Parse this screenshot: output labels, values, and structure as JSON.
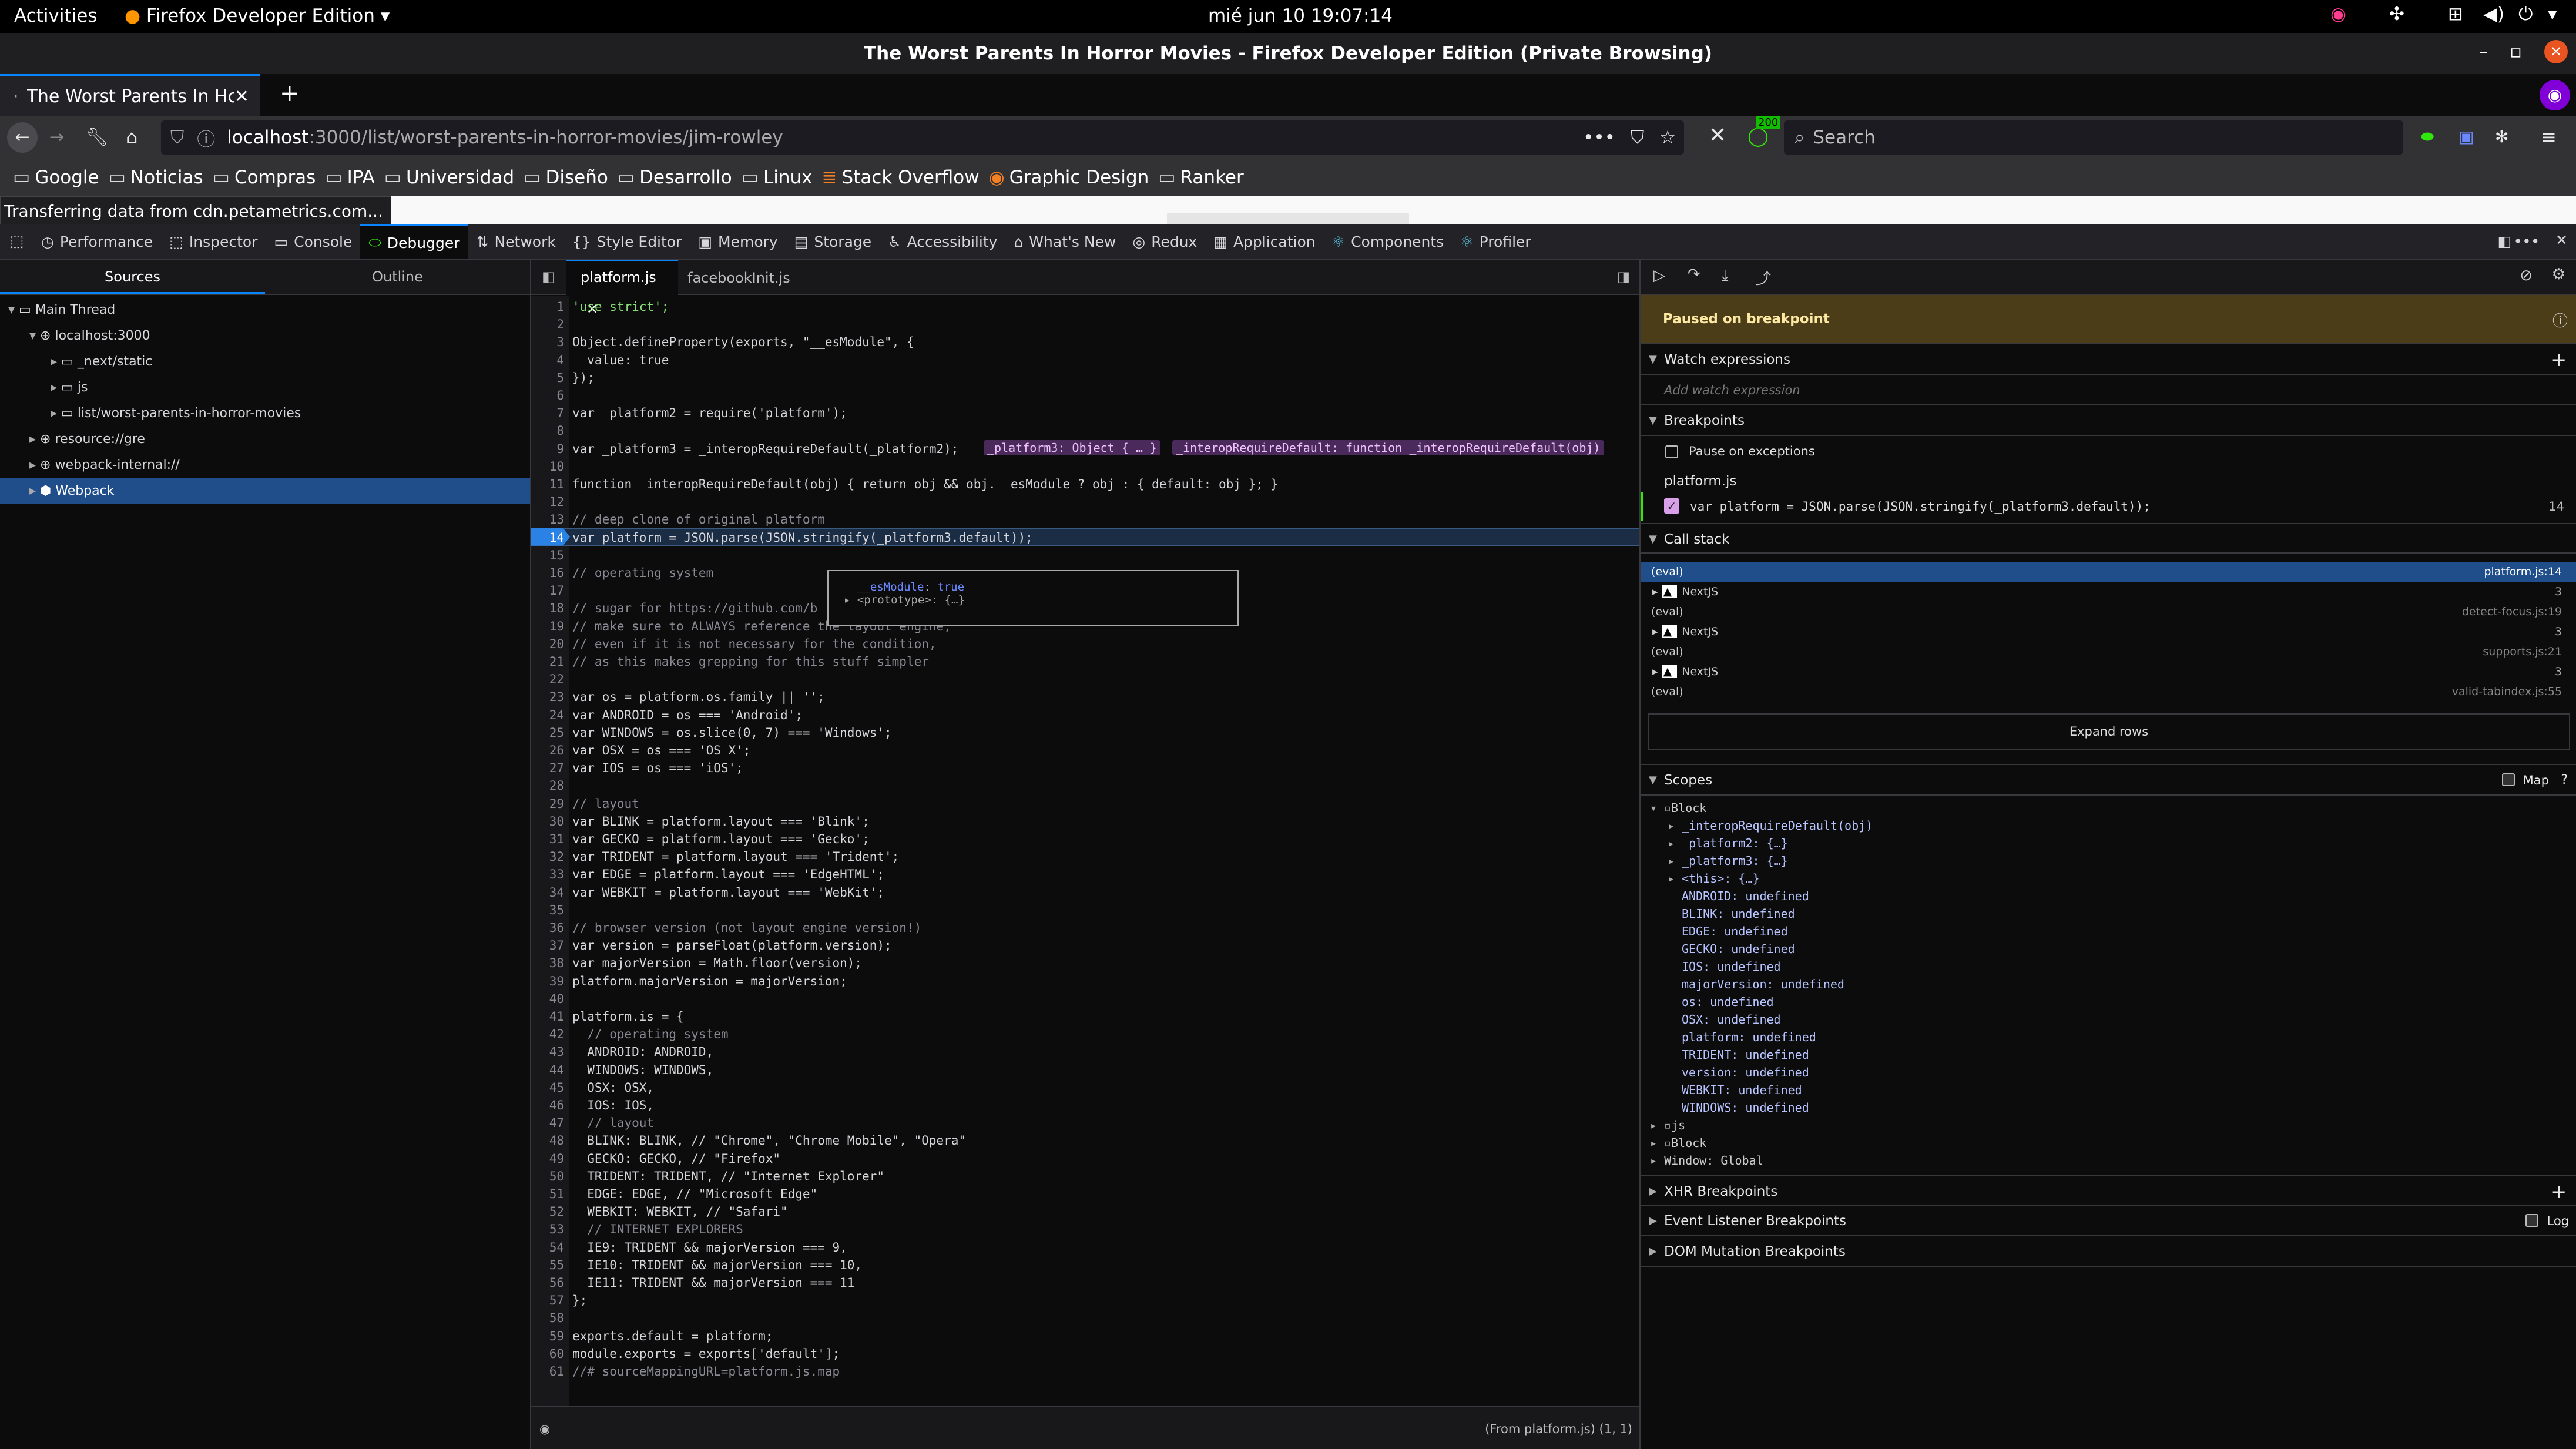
{
  "os": {
    "activities": "Activities",
    "app": "Firefox Developer Edition",
    "clock": "mié jun 10  19:07:14"
  },
  "window": {
    "title": "The Worst Parents In Horror Movies - Firefox Developer Edition (Private Browsing)"
  },
  "tab": {
    "title": "The Worst Parents In Ho"
  },
  "nav": {
    "url_host": "localhost",
    "url_rest": ":3000/list/worst-parents-in-horror-movies/jim-rowley",
    "search_placeholder": "Search",
    "badge": "200"
  },
  "bookmarks": [
    "Google",
    "Noticias",
    "Compras",
    "IPA",
    "Universidad",
    "Diseño",
    "Desarrollo",
    "Linux",
    "Stack Overflow",
    "Graphic Design",
    "Ranker"
  ],
  "status": {
    "text": "Transferring data from cdn.petametrics.com..."
  },
  "devtools": {
    "tabs": [
      "Performance",
      "Inspector",
      "Console",
      "Debugger",
      "Network",
      "Style Editor",
      "Memory",
      "Storage",
      "Accessibility",
      "What's New",
      "Redux",
      "Application",
      "Components",
      "Profiler"
    ],
    "selected": "Debugger"
  },
  "sources": {
    "tabs": [
      "Sources",
      "Outline"
    ],
    "tree": [
      {
        "label": "Main Thread",
        "depth": 0,
        "icon": "window-icon"
      },
      {
        "label": "localhost:3000",
        "depth": 1,
        "icon": "globe-icon"
      },
      {
        "label": "_next/static",
        "depth": 2,
        "icon": "folder-icon"
      },
      {
        "label": "js",
        "depth": 2,
        "icon": "folder-icon"
      },
      {
        "label": "list/worst-parents-in-horror-movies",
        "depth": 2,
        "icon": "folder-icon"
      },
      {
        "label": "resource://gre",
        "depth": 1,
        "icon": "globe-icon"
      },
      {
        "label": "webpack-internal://",
        "depth": 1,
        "icon": "globe-icon"
      },
      {
        "label": "Webpack",
        "depth": 1,
        "icon": "webpack-icon"
      }
    ]
  },
  "editor": {
    "tabs": [
      "platform.js",
      "facebookInit.js"
    ],
    "lines": [
      "'use strict';",
      "",
      "Object.defineProperty(exports, \"__esModule\", {",
      "  value: true",
      "});",
      "",
      "var _platform2 = require('platform');",
      "",
      "var _platform3 = _interopRequireDefault(_platform2);",
      "",
      "function _interopRequireDefault(obj) { return obj && obj.__esModule ? obj : { default: obj }; }",
      "",
      "// deep clone of original platform",
      "var platform = JSON.parse(JSON.stringify(_platform3.default));",
      "",
      "// operating system",
      "",
      "// sugar for https://github.com/b",
      "// make sure to ALWAYS reference the layout engine,",
      "// even if it is not necessary for the condition,",
      "// as this makes grepping for this stuff simpler",
      "",
      "var os = platform.os.family || '';",
      "var ANDROID = os === 'Android';",
      "var WINDOWS = os.slice(0, 7) === 'Windows';",
      "var OSX = os === 'OS X';",
      "var IOS = os === 'iOS';",
      "",
      "// layout",
      "var BLINK = platform.layout === 'Blink';",
      "var GECKO = platform.layout === 'Gecko';",
      "var TRIDENT = platform.layout === 'Trident';",
      "var EDGE = platform.layout === 'EdgeHTML';",
      "var WEBKIT = platform.layout === 'WebKit';",
      "",
      "// browser version (not layout engine version!)",
      "var version = parseFloat(platform.version);",
      "var majorVersion = Math.floor(version);",
      "platform.majorVersion = majorVersion;",
      "",
      "platform.is = {",
      "  // operating system",
      "  ANDROID: ANDROID,",
      "  WINDOWS: WINDOWS,",
      "  OSX: OSX,",
      "  IOS: IOS,",
      "  // layout",
      "  BLINK: BLINK, // \"Chrome\", \"Chrome Mobile\", \"Opera\"",
      "  GECKO: GECKO, // \"Firefox\"",
      "  TRIDENT: TRIDENT, // \"Internet Explorer\"",
      "  EDGE: EDGE, // \"Microsoft Edge\"",
      "  WEBKIT: WEBKIT, // \"Safari\"",
      "  // INTERNET EXPLORERS",
      "  IE9: TRIDENT && majorVersion === 9,",
      "  IE10: TRIDENT && majorVersion === 10,",
      "  IE11: TRIDENT && majorVersion === 11",
      "};",
      "",
      "exports.default = platform;",
      "module.exports = exports['default'];",
      "//# sourceMappingURL=platform.js.map"
    ],
    "current_line": 14,
    "inline_preview": {
      "a": "_platform3: Object { … }",
      "b": "_interopRequireDefault: function _interopRequireDefault(obj)"
    },
    "tooltip": {
      "key": "__esModule",
      "value": "true",
      "proto": "<prototype>: {…}"
    },
    "footer": "(From platform.js)  (1, 1)"
  },
  "debugger": {
    "paused": "Paused on breakpoint",
    "watch": {
      "title": "Watch expressions",
      "placeholder": "Add watch expression"
    },
    "breakpoints": {
      "title": "Breakpoints",
      "pause_exceptions": "Pause on exceptions",
      "file": "platform.js",
      "code": "var platform = JSON.parse(JSON.stringify(_platform3.default));",
      "line": "14"
    },
    "callstack": {
      "title": "Call stack",
      "frames": [
        {
          "name": "(eval)",
          "loc": "platform.js:14",
          "selected": true
        },
        {
          "group": "NextJS",
          "count": "3"
        },
        {
          "name": "(eval)",
          "loc": "detect-focus.js:19"
        },
        {
          "group": "NextJS",
          "count": "3"
        },
        {
          "name": "(eval)",
          "loc": "supports.js:21"
        },
        {
          "group": "NextJS",
          "count": "3"
        },
        {
          "name": "(eval)",
          "loc": "valid-tabindex.js:55"
        }
      ],
      "expand": "Expand rows"
    },
    "scopes": {
      "title": "Scopes",
      "map": "Map",
      "items": [
        "Block",
        "_interopRequireDefault(obj)",
        "_platform2: {…}",
        "_platform3: {…}",
        "<this>: {…}",
        "ANDROID: undefined",
        "BLINK: undefined",
        "EDGE: undefined",
        "GECKO: undefined",
        "IOS: undefined",
        "majorVersion: undefined",
        "os: undefined",
        "OSX: undefined",
        "platform: undefined",
        "TRIDENT: undefined",
        "version: undefined",
        "WEBKIT: undefined",
        "WINDOWS: undefined",
        "js",
        "Block",
        "Window: Global"
      ]
    },
    "xhr": "XHR Breakpoints",
    "event": "Event Listener Breakpoints",
    "log": "Log",
    "dom": "DOM Mutation Breakpoints"
  },
  "colors": {
    "accent": "#0a84ff",
    "selection": "#204e8a",
    "paused": "#4a3d18",
    "keyword": "#ff7de9",
    "string": "#86de74"
  }
}
